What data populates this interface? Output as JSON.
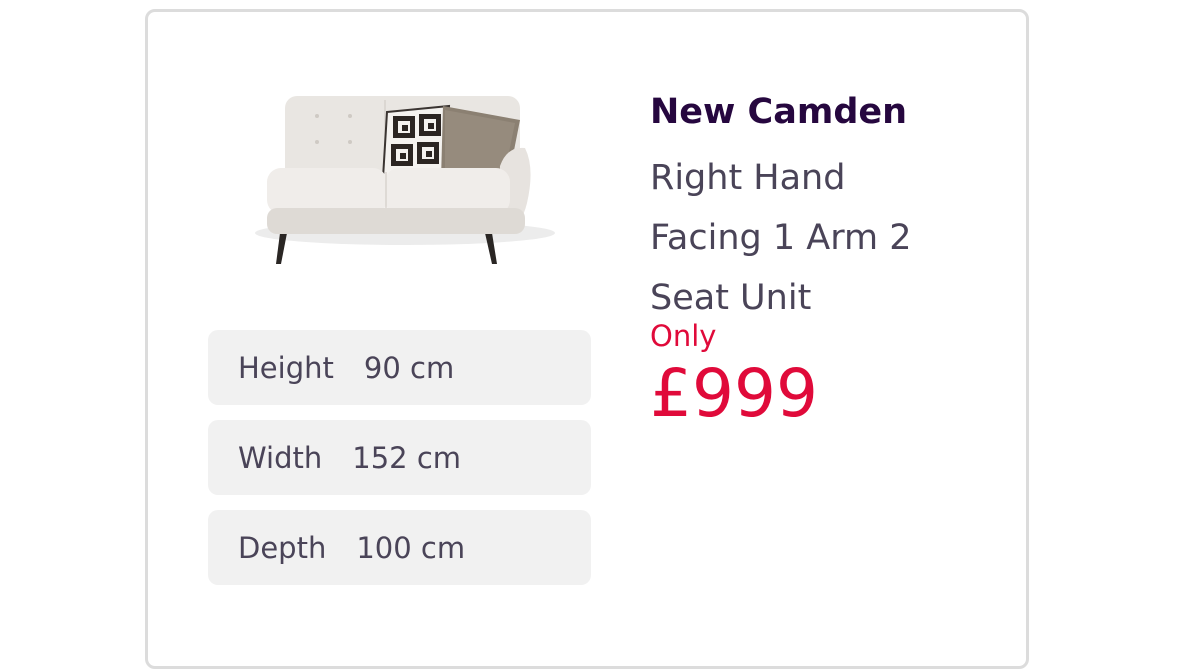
{
  "product": {
    "name": "New Camden",
    "description_lines": [
      "Right Hand",
      "Facing 1 Arm 2",
      "Seat Unit"
    ],
    "only_label": "Only",
    "price": "£999"
  },
  "dimensions": [
    {
      "label": "Height",
      "value": "90 cm"
    },
    {
      "label": "Width",
      "value": "152 cm"
    },
    {
      "label": "Depth",
      "value": "100 cm"
    }
  ],
  "colors": {
    "price_red": "#e00a3a",
    "title_purple": "#26073f",
    "text_gray": "#4a4458",
    "dimension_bg": "#f1f1f1",
    "card_border": "#dcdcdc"
  }
}
